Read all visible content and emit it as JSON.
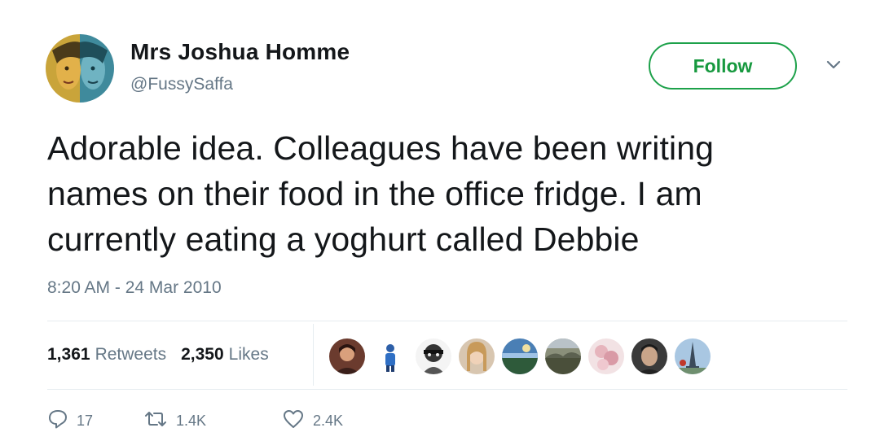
{
  "user": {
    "name": "Mrs Joshua Homme",
    "handle": "@FussySaffa"
  },
  "follow_label": "Follow",
  "tweet": {
    "text": "Adorable idea.  Colleagues have been writing\nnames on their food in the office fridge.  I am\ncurrently eating a yoghurt called Debbie",
    "timestamp": "8:20 AM - 24 Mar 2010"
  },
  "stats": {
    "retweets_count": "1,361",
    "retweets_label": "Retweets",
    "likes_count": "2,350",
    "likes_label": "Likes"
  },
  "likers_avatars": 9,
  "actions": {
    "replies": "17",
    "retweets": "1.4K",
    "likes": "2.4K"
  },
  "colors": {
    "follow_green": "#1da14a",
    "text": "#14171a",
    "muted": "#657786",
    "divider": "#e6ecf0"
  },
  "icons": [
    "caret-down-icon",
    "reply-icon",
    "retweet-icon",
    "heart-icon"
  ]
}
